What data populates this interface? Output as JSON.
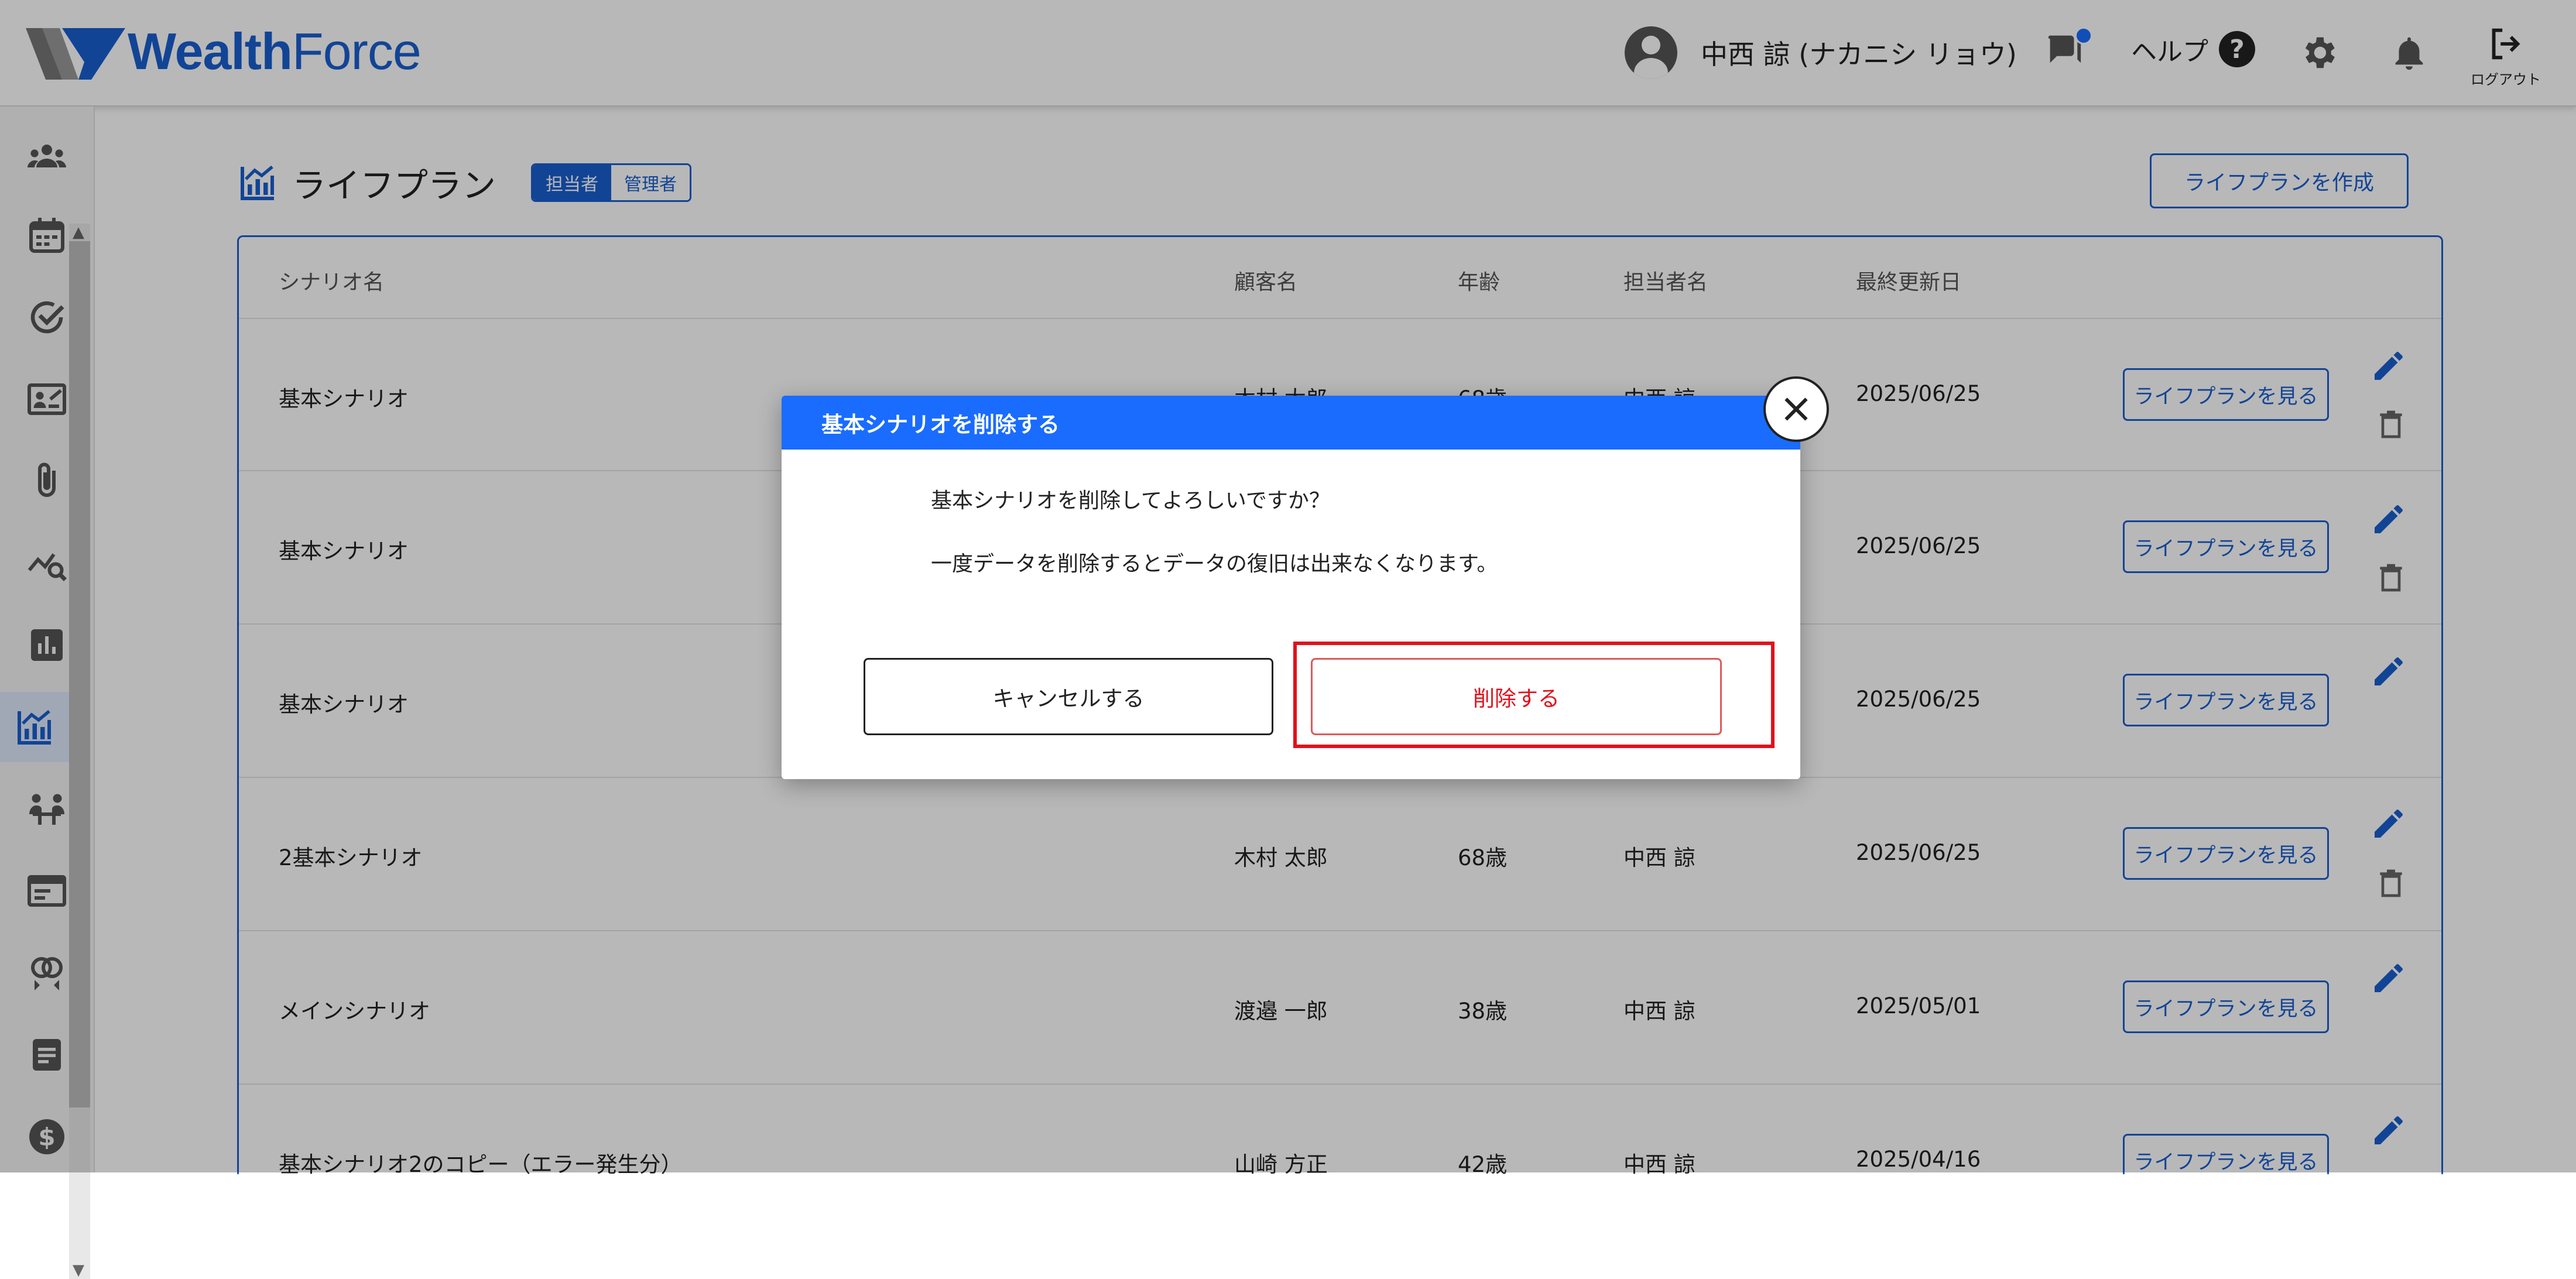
{
  "header": {
    "logo_bold": "Wealth",
    "logo_light": "Force",
    "user_name": "中西 諒 (ナカニシ リョウ)",
    "help_label": "ヘルプ",
    "help_mark": "?",
    "logout_label": "ログアウト"
  },
  "page": {
    "title": "ライフプラン",
    "roles": [
      "担当者",
      "管理者"
    ],
    "active_role": "担当者",
    "create_button": "ライフプランを作成"
  },
  "table": {
    "columns": [
      "シナリオ名",
      "顧客名",
      "年齢",
      "担当者名",
      "最終更新日"
    ],
    "view_button_label": "ライフプランを見る",
    "rows": [
      {
        "scenario": "基本シナリオ",
        "customer": "木村 太郎",
        "age": "68歳",
        "manager": "中西 諒",
        "updated": "2025/06/25",
        "deletable": true
      },
      {
        "scenario": "基本シナリオ",
        "customer": "",
        "age": "",
        "manager": "",
        "updated": "2025/06/25",
        "deletable": true
      },
      {
        "scenario": "基本シナリオ",
        "customer": "",
        "age": "",
        "manager": "",
        "updated": "2025/06/25",
        "deletable": false
      },
      {
        "scenario": "2基本シナリオ",
        "customer": "木村 太郎",
        "age": "68歳",
        "manager": "中西 諒",
        "updated": "2025/06/25",
        "deletable": true
      },
      {
        "scenario": "メインシナリオ",
        "customer": "渡邉 一郎",
        "age": "38歳",
        "manager": "中西 諒",
        "updated": "2025/05/01",
        "deletable": false
      },
      {
        "scenario": "基本シナリオ2のコピー（エラー発生分）",
        "customer": "山崎 方正",
        "age": "42歳",
        "manager": "中西 諒",
        "updated": "2025/04/16",
        "deletable": false
      }
    ]
  },
  "modal": {
    "title": "基本シナリオを削除する",
    "message1": "基本シナリオを削除してよろしいですか？",
    "message2": "一度データを削除するとデータの復旧は出来なくなります。",
    "cancel_label": "キャンセルする",
    "delete_label": "削除する"
  },
  "colors": {
    "brand": "#1a5fd0",
    "modal_header": "#1a6cff",
    "danger": "#e0121c"
  },
  "sidebar_icons": [
    "users-icon",
    "calendar-icon",
    "check-circle-icon",
    "id-card-icon",
    "paperclip-icon",
    "analytics-search-icon",
    "bar-chart-icon",
    "lifeplan-chart-icon",
    "meeting-icon",
    "window-icon",
    "rings-icon",
    "document-icon",
    "dollar-icon"
  ]
}
